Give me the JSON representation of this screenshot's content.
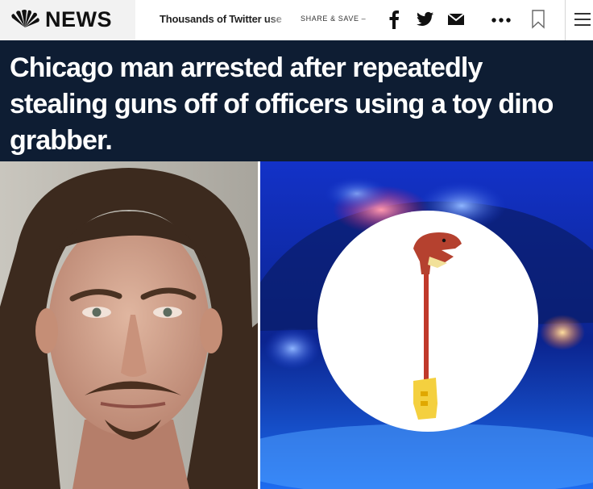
{
  "nav": {
    "brand": "NEWS",
    "headline_tease": "Thousands of Twitter use",
    "share_save": "SHARE & SAVE –",
    "icons": [
      "nbc-peacock-logo",
      "facebook-icon",
      "twitter-icon",
      "mail-icon",
      "more-icon",
      "bookmark-icon",
      "menu-icon"
    ]
  },
  "article": {
    "headline": "Chicago man arrested after repeatedly stealing guns off of officers using a toy dino grabber."
  },
  "colors": {
    "headline_band": "#0e1d33",
    "nav_background": "#ffffff",
    "police_blue": "#0a2a8a",
    "grabber_red": "#c0392b",
    "grabber_yellow": "#f4d03f"
  }
}
